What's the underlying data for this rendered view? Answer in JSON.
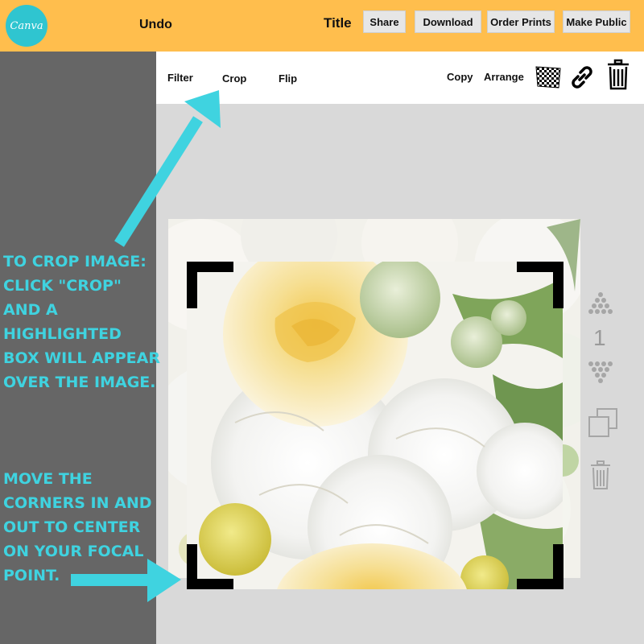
{
  "header": {
    "logo_text": "Canva",
    "undo_label": "Undo",
    "title": "Title",
    "share_label": "Share",
    "download_label": "Download",
    "order_prints_label": "Order Prints",
    "make_public_label": "Make Public"
  },
  "toolbar": {
    "filter_label": "Filter",
    "crop_label": "Crop",
    "flip_label": "Flip",
    "copy_label": "Copy",
    "arrange_label": "Arrange",
    "icons": [
      "transparency-icon",
      "link-icon",
      "trash-icon"
    ]
  },
  "side_controls": {
    "page_number": "1",
    "icons": [
      "move-forward-icon",
      "move-backward-icon",
      "duplicate-icon",
      "delete-icon"
    ]
  },
  "instructions": {
    "step1": "TO CROP IMAGE:\nCLICK \"CROP\"\nAND A\nHIGHLIGHTED\nBOX WILL APPEAR\nOVER THE IMAGE.",
    "step2": "MOVE THE\nCORNERS IN AND\nOUT TO CENTER\nON YOUR FOCAL\nPOINT."
  },
  "colors": {
    "header_bg": "#ffbe4d",
    "logo_bg": "#2fc5d0",
    "sidebar_bg": "#666666",
    "annotation": "#3fd3e0",
    "crop_corner": "#000000"
  }
}
